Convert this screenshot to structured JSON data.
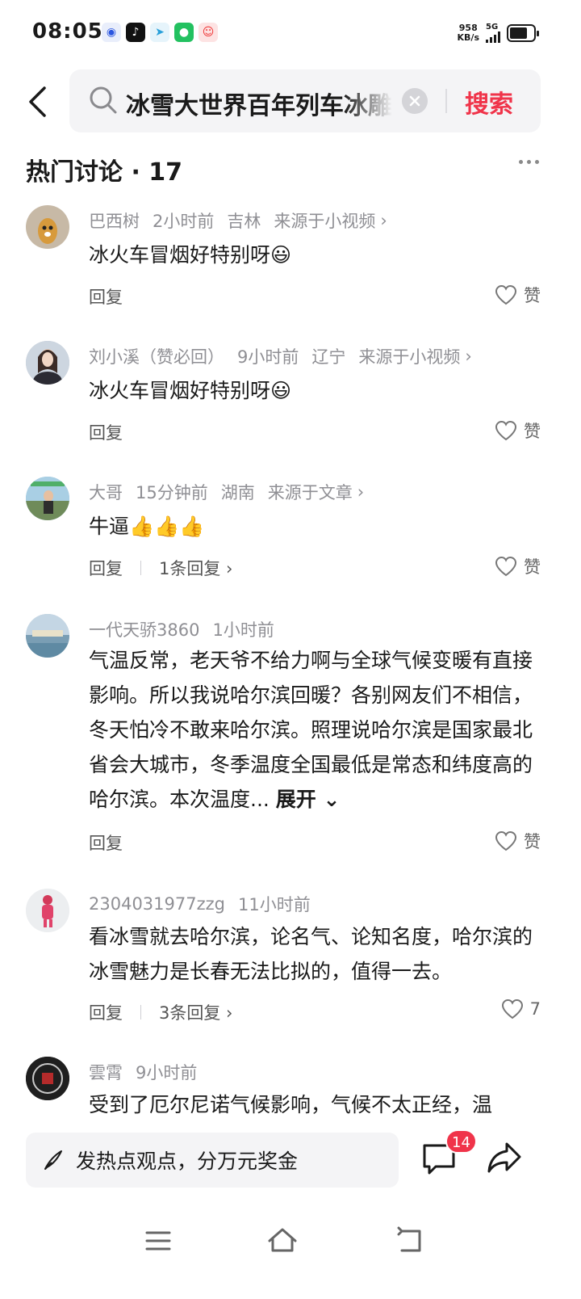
{
  "status_bar": {
    "time": "08:05",
    "net_speed_value": "958",
    "net_speed_unit": "KB/s",
    "network": "5G",
    "battery_percent": 75
  },
  "search": {
    "query": "冰雪大世界百年列车冰雕",
    "button_label": "搜索"
  },
  "section": {
    "title": "热门讨论 · 17"
  },
  "comments": [
    {
      "user": "巴西树",
      "time": "2小时前",
      "location": "吉林",
      "source": "来源于小视频",
      "text": "冰火车冒烟好特别呀😃",
      "reply_label": "回复",
      "like_label": "赞"
    },
    {
      "user": "刘小溪（赞必回）",
      "time": "9小时前",
      "location": "辽宁",
      "source": "来源于小视频",
      "text": "冰火车冒烟好特别呀😃",
      "reply_label": "回复",
      "like_label": "赞"
    },
    {
      "user": "大哥",
      "time": "15分钟前",
      "location": "湖南",
      "source": "来源于文章",
      "text": "牛逼👍👍👍",
      "reply_label": "回复",
      "replies": "1条回复",
      "like_label": "赞"
    },
    {
      "user": "一代天骄3860",
      "time": "1小时前",
      "text": "气温反常，老天爷不给力啊与全球气候变暖有直接影响。所以我说哈尔滨回暖？各别网友们不相信，冬天怕冷不敢来哈尔滨。照理说哈尔滨是国家最北省会大城市，冬季温度全国最低是常态和纬度高的哈尔滨。本次温度...",
      "expand_label": "展开",
      "reply_label": "回复",
      "like_label": "赞"
    },
    {
      "user": "2304031977zzg",
      "time": "11小时前",
      "text": "看冰雪就去哈尔滨，论名气、论知名度，哈尔滨的冰雪魅力是长春无法比拟的，值得一去。",
      "reply_label": "回复",
      "replies": "3条回复",
      "like_count": "7"
    },
    {
      "user": "雲霄",
      "time": "9小时前",
      "text": "受到了厄尔尼诺气候影响，气候不太正经，温"
    }
  ],
  "bottom_bar": {
    "post_placeholder": "发热点观点，分万元奖金",
    "comment_badge": "14"
  }
}
